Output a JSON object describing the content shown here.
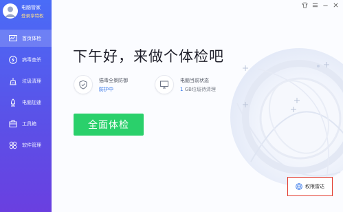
{
  "profile": {
    "name": "电脑管家",
    "sub": "登录享特权"
  },
  "nav": [
    {
      "label": "首页体检",
      "icon": "chart-icon"
    },
    {
      "label": "病毒查杀",
      "icon": "lightning-icon"
    },
    {
      "label": "垃圾清理",
      "icon": "broom-icon"
    },
    {
      "label": "电脑加速",
      "icon": "rocket-icon"
    },
    {
      "label": "工具箱",
      "icon": "toolbox-icon"
    },
    {
      "label": "软件管理",
      "icon": "apps-icon"
    }
  ],
  "window_controls": [
    "shirt-icon",
    "menu-icon",
    "minimize-icon",
    "close-icon"
  ],
  "main": {
    "greeting": "下午好，来做个体检吧",
    "virus_protect": {
      "title": "猫毒全景防御",
      "status": "防护中"
    },
    "pc_status": {
      "title": "电脑当前状态",
      "value_num": "1",
      "value_rest": " GB垃圾待清理"
    },
    "check_button": "全面体检",
    "radar_label": "权限雷达"
  },
  "colors": {
    "sidebar_top": "#4a6cf7",
    "sidebar_bottom": "#6a3fe0",
    "accent_blue": "#2a6fe8",
    "button_green": "#2ad06b",
    "radar_border": "#e23a2e"
  }
}
